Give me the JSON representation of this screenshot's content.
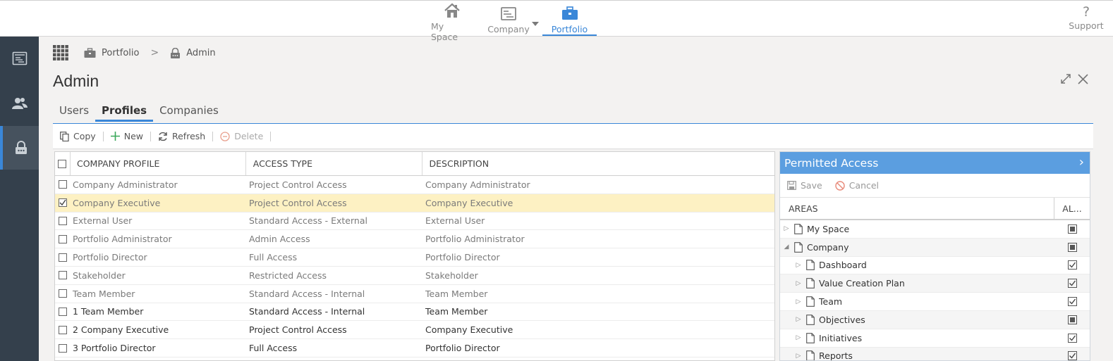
{
  "topnav": {
    "items": [
      {
        "key": "myspace",
        "label": "My Space",
        "icon": "home-icon"
      },
      {
        "key": "company",
        "label": "Company",
        "icon": "company-icon"
      },
      {
        "key": "portfolio",
        "label": "Portfolio",
        "icon": "briefcase-icon",
        "active": true
      }
    ],
    "support_label": "Support",
    "support_glyph": "?"
  },
  "sidebar": {
    "items": [
      {
        "icon": "document-list-icon"
      },
      {
        "icon": "users-icon"
      },
      {
        "icon": "lock-icon",
        "active": true
      }
    ]
  },
  "breadcrumb": {
    "items": [
      {
        "label": "Portfolio",
        "icon": "briefcase-icon"
      },
      {
        "label": "Admin",
        "icon": "lock-icon"
      }
    ],
    "separator": ">"
  },
  "page": {
    "title": "Admin"
  },
  "tabs": [
    {
      "label": "Users"
    },
    {
      "label": "Profiles",
      "active": true
    },
    {
      "label": "Companies"
    }
  ],
  "toolbar": {
    "copy_label": "Copy",
    "new_label": "New",
    "refresh_label": "Refresh",
    "delete_label": "Delete"
  },
  "grid": {
    "columns": [
      "COMPANY PROFILE",
      "ACCESS TYPE",
      "DESCRIPTION"
    ],
    "rows": [
      {
        "profile": "Company Administrator",
        "access": "Project Control Access",
        "description": "Company Administrator",
        "checked": false,
        "selected": false,
        "dark": false
      },
      {
        "profile": "Company Executive",
        "access": "Project Control Access",
        "description": "Company Executive",
        "checked": true,
        "selected": true,
        "dark": false
      },
      {
        "profile": "External User",
        "access": "Standard Access - External",
        "description": "External User",
        "checked": false,
        "selected": false,
        "dark": false
      },
      {
        "profile": "Portfolio Administrator",
        "access": "Admin Access",
        "description": "Portfolio Administrator",
        "checked": false,
        "selected": false,
        "dark": false
      },
      {
        "profile": "Portfolio Director",
        "access": "Full Access",
        "description": "Portfolio Director",
        "checked": false,
        "selected": false,
        "dark": false
      },
      {
        "profile": "Stakeholder",
        "access": "Restricted Access",
        "description": "Stakeholder",
        "checked": false,
        "selected": false,
        "dark": false
      },
      {
        "profile": "Team Member",
        "access": "Standard Access - Internal",
        "description": "Team Member",
        "checked": false,
        "selected": false,
        "dark": false
      },
      {
        "profile": "1 Team Member",
        "access": "Standard Access - Internal",
        "description": "Team Member",
        "checked": false,
        "selected": false,
        "dark": true
      },
      {
        "profile": "2 Company Executive",
        "access": "Project Control Access",
        "description": "Company Executive",
        "checked": false,
        "selected": false,
        "dark": true
      },
      {
        "profile": "3 Portfolio Director",
        "access": "Full Access",
        "description": "Portfolio Director",
        "checked": false,
        "selected": false,
        "dark": true
      }
    ]
  },
  "permitted_access": {
    "title": "Permitted Access",
    "save_label": "Save",
    "cancel_label": "Cancel",
    "columns": {
      "areas": "AREAS",
      "allowed": "AL..."
    },
    "tree": [
      {
        "label": "My Space",
        "level": 0,
        "expanded": false,
        "state": "partial"
      },
      {
        "label": "Company",
        "level": 0,
        "expanded": true,
        "state": "partial"
      },
      {
        "label": "Dashboard",
        "level": 1,
        "expanded": false,
        "state": "checked"
      },
      {
        "label": "Value Creation Plan",
        "level": 1,
        "expanded": false,
        "state": "checked"
      },
      {
        "label": "Team",
        "level": 1,
        "expanded": false,
        "state": "checked"
      },
      {
        "label": "Objectives",
        "level": 1,
        "expanded": false,
        "state": "partial"
      },
      {
        "label": "Initiatives",
        "level": 1,
        "expanded": false,
        "state": "checked"
      },
      {
        "label": "Reports",
        "level": 1,
        "expanded": false,
        "state": "checked"
      }
    ]
  }
}
